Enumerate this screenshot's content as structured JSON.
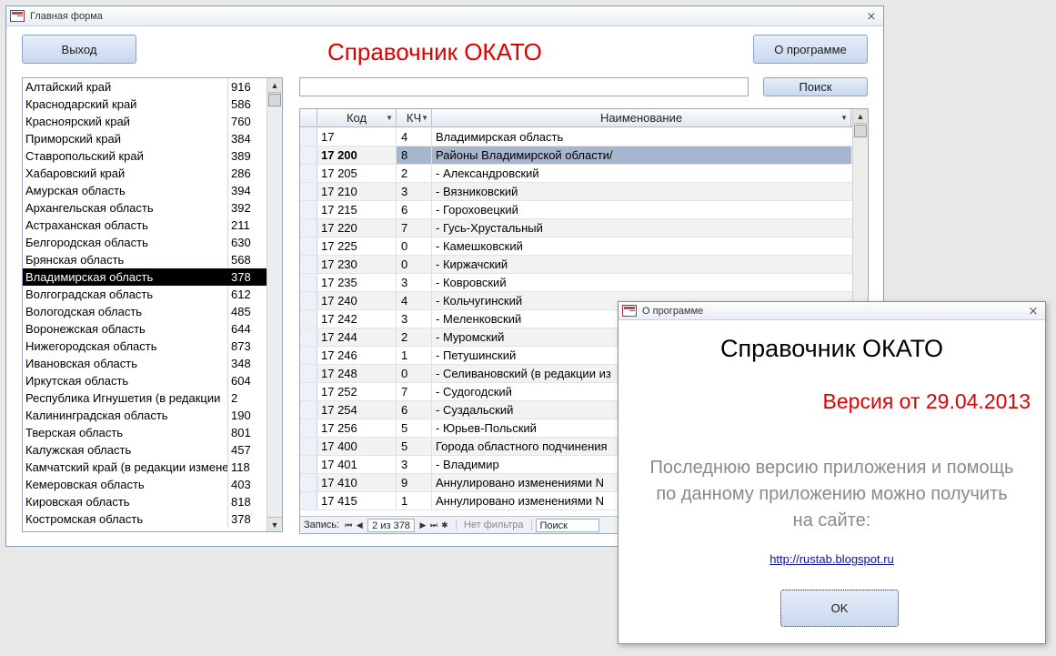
{
  "main_window": {
    "title": "Главная форма",
    "close_glyph": "⨯",
    "exit_label": "Выход",
    "about_label": "О программе",
    "form_title": "Справочник ОКАТО",
    "search_label": "Поиск"
  },
  "regions": [
    {
      "name": "Алтайский край",
      "code": "916"
    },
    {
      "name": "Краснодарский край",
      "code": "586"
    },
    {
      "name": "Красноярский край",
      "code": "760"
    },
    {
      "name": "Приморский край",
      "code": "384"
    },
    {
      "name": "Ставропольский край",
      "code": "389"
    },
    {
      "name": "Хабаровский край",
      "code": "286"
    },
    {
      "name": "Амурская область",
      "code": "394"
    },
    {
      "name": "Архангельская область",
      "code": "392"
    },
    {
      "name": "Астраханская область",
      "code": "211"
    },
    {
      "name": "Белгородская область",
      "code": "630"
    },
    {
      "name": "Брянская область",
      "code": "568"
    },
    {
      "name": "Владимирская область",
      "code": "378"
    },
    {
      "name": "Волгоградская область",
      "code": "612"
    },
    {
      "name": "Вологодская область",
      "code": "485"
    },
    {
      "name": "Воронежская область",
      "code": "644"
    },
    {
      "name": "Нижегородская область",
      "code": "873"
    },
    {
      "name": "Ивановская область",
      "code": "348"
    },
    {
      "name": "Иркутская область",
      "code": "604"
    },
    {
      "name": "Республика Игнушетия (в редакции",
      "code": "2"
    },
    {
      "name": "Калининградская область",
      "code": "190"
    },
    {
      "name": "Тверская область",
      "code": "801"
    },
    {
      "name": "Калужская область",
      "code": "457"
    },
    {
      "name": "Камчатский край (в редакции измене",
      "code": "118"
    },
    {
      "name": "Кемеровская область",
      "code": "403"
    },
    {
      "name": "Кировская область",
      "code": "818"
    },
    {
      "name": "Костромская область",
      "code": "378"
    }
  ],
  "selected_region_index": 11,
  "grid": {
    "columns": {
      "code": "Код",
      "kch": "КЧ",
      "name": "Наименование"
    },
    "rows": [
      {
        "code": "17",
        "kch": "4",
        "name": "Владимирская область"
      },
      {
        "code": "17 200",
        "kch": "8",
        "name": "Районы Владимирской области/"
      },
      {
        "code": "17 205",
        "kch": "2",
        "name": "- Александровский"
      },
      {
        "code": "17 210",
        "kch": "3",
        "name": "- Вязниковский"
      },
      {
        "code": "17 215",
        "kch": "6",
        "name": "- Гороховецкий"
      },
      {
        "code": "17 220",
        "kch": "7",
        "name": "- Гусь-Хрустальный"
      },
      {
        "code": "17 225",
        "kch": "0",
        "name": "- Камешковский"
      },
      {
        "code": "17 230",
        "kch": "0",
        "name": "- Киржачский"
      },
      {
        "code": "17 235",
        "kch": "3",
        "name": "- Ковровский"
      },
      {
        "code": "17 240",
        "kch": "4",
        "name": "- Кольчугинский"
      },
      {
        "code": "17 242",
        "kch": "3",
        "name": "- Меленковский"
      },
      {
        "code": "17 244",
        "kch": "2",
        "name": "- Муромский"
      },
      {
        "code": "17 246",
        "kch": "1",
        "name": "- Петушинский"
      },
      {
        "code": "17 248",
        "kch": "0",
        "name": "- Селивановский (в редакции из"
      },
      {
        "code": "17 252",
        "kch": "7",
        "name": "- Судогодский"
      },
      {
        "code": "17 254",
        "kch": "6",
        "name": "- Суздальский"
      },
      {
        "code": "17 256",
        "kch": "5",
        "name": "- Юрьев-Польский"
      },
      {
        "code": "17 400",
        "kch": "5",
        "name": "Города областного подчинения"
      },
      {
        "code": "17 401",
        "kch": "3",
        "name": "- Владимир"
      },
      {
        "code": "17 410",
        "kch": "9",
        "name": "Аннулировано изменениями N"
      },
      {
        "code": "17 415",
        "kch": "1",
        "name": "Аннулировано изменениями N"
      }
    ],
    "current_row_index": 1
  },
  "navigator": {
    "record_label": "Запись:",
    "position": "2 из 378",
    "filter_label": "Нет фильтра",
    "search_label": "Поиск"
  },
  "about_dialog": {
    "title": "О программе",
    "heading": "Справочник ОКАТО",
    "version": "Версия от 29.04.2013",
    "text_line1": "Последнюю версию приложения и помощь",
    "text_line2": "по данному приложению можно получить",
    "text_line3": "на сайте:",
    "link": "http://rustab.blogspot.ru",
    "ok_label": "OK"
  }
}
